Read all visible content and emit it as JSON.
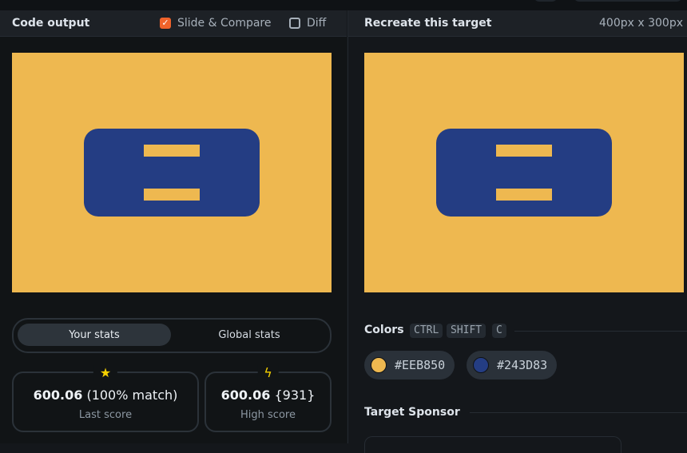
{
  "left": {
    "title": "Code output",
    "slide_compare": {
      "label": "Slide & Compare",
      "checked": true
    },
    "diff": {
      "label": "Diff",
      "checked": false
    }
  },
  "right": {
    "title": "Recreate this target",
    "dims": "400px x 300px"
  },
  "target_colors": {
    "background": "#EEB850",
    "shape": "#243D83"
  },
  "stats": {
    "tabs": [
      "Your stats",
      "Global stats"
    ],
    "active_tab": "Your stats",
    "last": {
      "icon": "star-icon",
      "score": "600.06",
      "extra": "(100% match)",
      "label": "Last score"
    },
    "high": {
      "icon": "lightning-icon",
      "score": "600.06",
      "extra": "{931}",
      "label": "High score"
    }
  },
  "colors_section": {
    "title": "Colors",
    "keys": [
      "CTRL",
      "SHIFT",
      "C"
    ],
    "chips": [
      {
        "hex": "#EEB850",
        "swatch": "#EEB850"
      },
      {
        "hex": "#243D83",
        "swatch": "#243D83"
      }
    ]
  },
  "sponsor": {
    "title": "Target Sponsor"
  }
}
